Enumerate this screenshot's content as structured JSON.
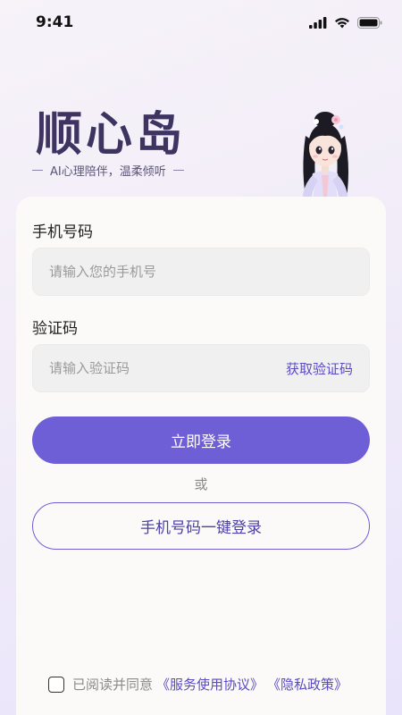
{
  "status_bar": {
    "time": "9:41"
  },
  "brand": {
    "title": "顺心岛",
    "subtitle": "AI心理陪伴，温柔倾听"
  },
  "form": {
    "phone": {
      "label": "手机号码",
      "placeholder": "请输入您的手机号",
      "value": ""
    },
    "code": {
      "label": "验证码",
      "placeholder": "请输入验证码",
      "value": "",
      "get_code_label": "获取验证码"
    },
    "login_button": "立即登录",
    "or_text": "或",
    "one_click_button": "手机号码一键登录"
  },
  "agreement": {
    "prefix": "已阅读并同意",
    "service_link": "《服务使用协议》",
    "privacy_link": "《隐私政策》",
    "checked": false
  },
  "colors": {
    "accent": "#6f5fd6",
    "title": "#3e3462",
    "link": "#5a4bc4"
  },
  "icons": [
    "signal-icon",
    "wifi-icon",
    "battery-icon",
    "mascot-illustration"
  ]
}
